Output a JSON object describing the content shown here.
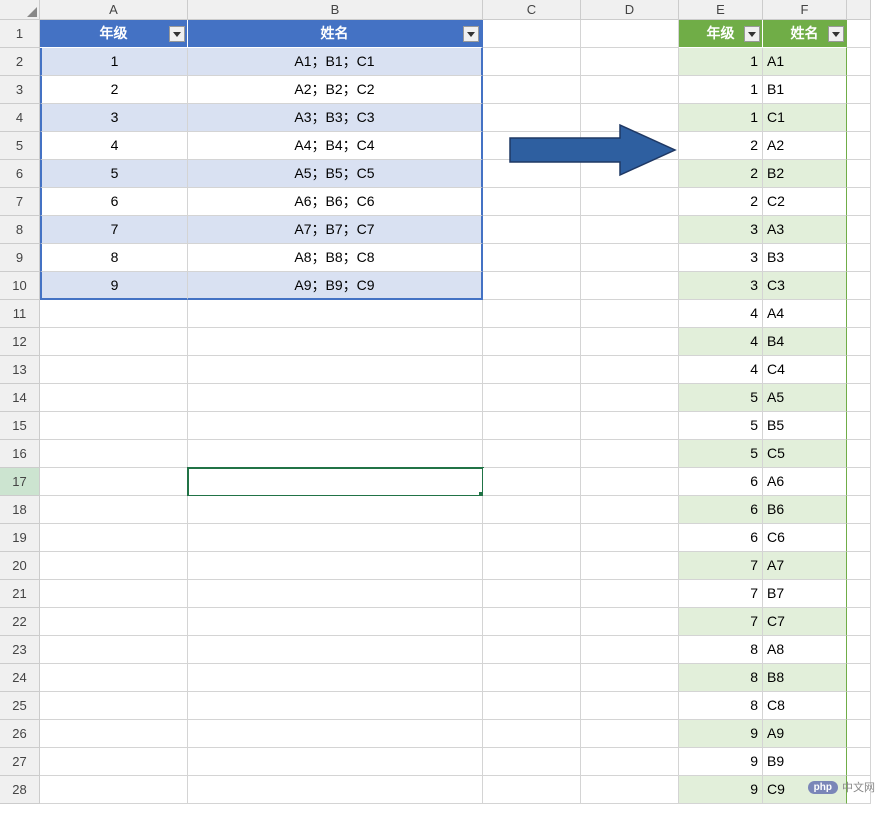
{
  "columns": [
    "A",
    "B",
    "C",
    "D",
    "E",
    "F",
    ""
  ],
  "rows": [
    "1",
    "2",
    "3",
    "4",
    "5",
    "6",
    "7",
    "8",
    "9",
    "10",
    "11",
    "12",
    "13",
    "14",
    "15",
    "16",
    "17",
    "18",
    "19",
    "20",
    "21",
    "22",
    "23",
    "24",
    "25",
    "26",
    "27",
    "28"
  ],
  "table1": {
    "headers": [
      "年级",
      "姓名"
    ],
    "data": [
      {
        "grade": "1",
        "name": "A1；B1；C1"
      },
      {
        "grade": "2",
        "name": "A2；B2；C2"
      },
      {
        "grade": "3",
        "name": "A3；B3；C3"
      },
      {
        "grade": "4",
        "name": "A4；B4；C4"
      },
      {
        "grade": "5",
        "name": "A5；B5；C5"
      },
      {
        "grade": "6",
        "name": "A6；B6；C6"
      },
      {
        "grade": "7",
        "name": "A7；B7；C7"
      },
      {
        "grade": "8",
        "name": "A8；B8；C8"
      },
      {
        "grade": "9",
        "name": "A9；B9；C9"
      }
    ]
  },
  "table2": {
    "headers": [
      "年级",
      "姓名"
    ],
    "data": [
      {
        "grade": "1",
        "name": "A1"
      },
      {
        "grade": "1",
        "name": "B1"
      },
      {
        "grade": "1",
        "name": "C1"
      },
      {
        "grade": "2",
        "name": "A2"
      },
      {
        "grade": "2",
        "name": "B2"
      },
      {
        "grade": "2",
        "name": "C2"
      },
      {
        "grade": "3",
        "name": "A3"
      },
      {
        "grade": "3",
        "name": "B3"
      },
      {
        "grade": "3",
        "name": "C3"
      },
      {
        "grade": "4",
        "name": "A4"
      },
      {
        "grade": "4",
        "name": "B4"
      },
      {
        "grade": "4",
        "name": "C4"
      },
      {
        "grade": "5",
        "name": "A5"
      },
      {
        "grade": "5",
        "name": "B5"
      },
      {
        "grade": "5",
        "name": "C5"
      },
      {
        "grade": "6",
        "name": "A6"
      },
      {
        "grade": "6",
        "name": "B6"
      },
      {
        "grade": "6",
        "name": "C6"
      },
      {
        "grade": "7",
        "name": "A7"
      },
      {
        "grade": "7",
        "name": "B7"
      },
      {
        "grade": "7",
        "name": "C7"
      },
      {
        "grade": "8",
        "name": "A8"
      },
      {
        "grade": "8",
        "name": "B8"
      },
      {
        "grade": "8",
        "name": "C8"
      },
      {
        "grade": "9",
        "name": "A9"
      },
      {
        "grade": "9",
        "name": "B9"
      },
      {
        "grade": "9",
        "name": "C9"
      }
    ]
  },
  "active_cell": "B17",
  "watermark": {
    "badge": "php",
    "text": "中文网"
  }
}
